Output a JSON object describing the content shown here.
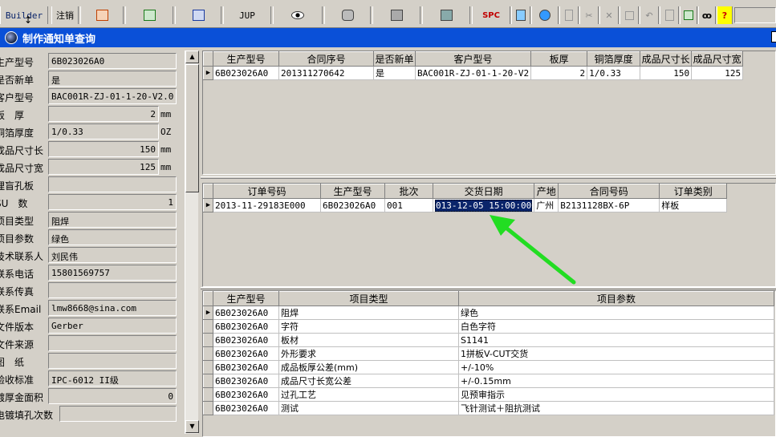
{
  "toolbar": {
    "builder": "Builder",
    "logout": "注销",
    "jup": "JUP",
    "spc": "SPC"
  },
  "window": {
    "title": "制作通知单查询"
  },
  "form": {
    "fields": [
      {
        "label": "生产型号",
        "value": "6B023026A0",
        "unit": ""
      },
      {
        "label": "是否新单",
        "value": "是",
        "unit": ""
      },
      {
        "label": "客户型号",
        "value": "BAC001R-ZJ-01-1-20-V2.0",
        "unit": ""
      },
      {
        "label": "板　厚",
        "value": "2",
        "unit": "mm"
      },
      {
        "label": "铜箔厚度",
        "value": "1/0.33",
        "unit": "OZ"
      },
      {
        "label": "成品尺寸长",
        "value": "150",
        "unit": "mm"
      },
      {
        "label": "成品尺寸宽",
        "value": "125",
        "unit": "mm"
      },
      {
        "label": "埋盲孔板",
        "value": "",
        "unit": ""
      },
      {
        "label": "SU　数",
        "value": "1",
        "unit": ""
      },
      {
        "label": "项目类型",
        "value": "阻焊",
        "unit": ""
      },
      {
        "label": "项目参数",
        "value": "绿色",
        "unit": ""
      },
      {
        "label": "技术联系人",
        "value": "刘民伟",
        "unit": ""
      },
      {
        "label": "联系电话",
        "value": "15801569757",
        "unit": ""
      },
      {
        "label": "联系传真",
        "value": "",
        "unit": ""
      },
      {
        "label": "联系Email",
        "value": "lmw8668@sina.com",
        "unit": ""
      },
      {
        "label": "文件版本",
        "value": "Gerber",
        "unit": ""
      },
      {
        "label": "文件来源",
        "value": "",
        "unit": ""
      },
      {
        "label": "图　纸",
        "value": "",
        "unit": ""
      },
      {
        "label": "验收标准",
        "value": "IPC-6012 II级",
        "unit": ""
      },
      {
        "label": "镀厚金面积",
        "value": "0",
        "unit": ""
      },
      {
        "label": "电镀填孔次数",
        "value": "",
        "unit": ""
      }
    ]
  },
  "grid1": {
    "headers": [
      "生产型号",
      "合同序号",
      "是否新单",
      "客户型号",
      "板厚",
      "铜箔厚度",
      "成品尺寸长",
      "成品尺寸宽"
    ],
    "rows": [
      [
        "6B023026A0",
        "201311270642",
        "是",
        "BAC001R-ZJ-01-1-20-V2",
        "2",
        "1/0.33",
        "150",
        "125"
      ]
    ]
  },
  "grid2": {
    "headers": [
      "订单号码",
      "生产型号",
      "批次",
      "交货日期",
      "产地",
      "合同号码",
      "订单类别"
    ],
    "rows": [
      [
        "2013-11-29183E000",
        "6B023026A0",
        "001",
        "013-12-05 15:00:00",
        "广州",
        "B2131128BX-6P",
        "样板"
      ]
    ]
  },
  "grid3": {
    "headers": [
      "生产型号",
      "项目类型",
      "项目参数"
    ],
    "rows": [
      [
        "6B023026A0",
        "阻焊",
        "绿色"
      ],
      [
        "6B023026A0",
        "字符",
        "白色字符"
      ],
      [
        "6B023026A0",
        "板材",
        "S1141"
      ],
      [
        "6B023026A0",
        "外形要求",
        "1拼板V-CUT交货"
      ],
      [
        "6B023026A0",
        "成品板厚公差(mm)",
        "+/-10%"
      ],
      [
        "6B023026A0",
        "成品尺寸长宽公差",
        "+/-0.15mm"
      ],
      [
        "6B023026A0",
        "过孔工艺",
        "见预审指示"
      ],
      [
        "6B023026A0",
        "测试",
        "飞针测试＋阻抗测试"
      ]
    ]
  },
  "colors": {
    "title_bar": "#0a50d8",
    "annotation_arrow": "#22dd22",
    "selection": "#0a246a"
  }
}
